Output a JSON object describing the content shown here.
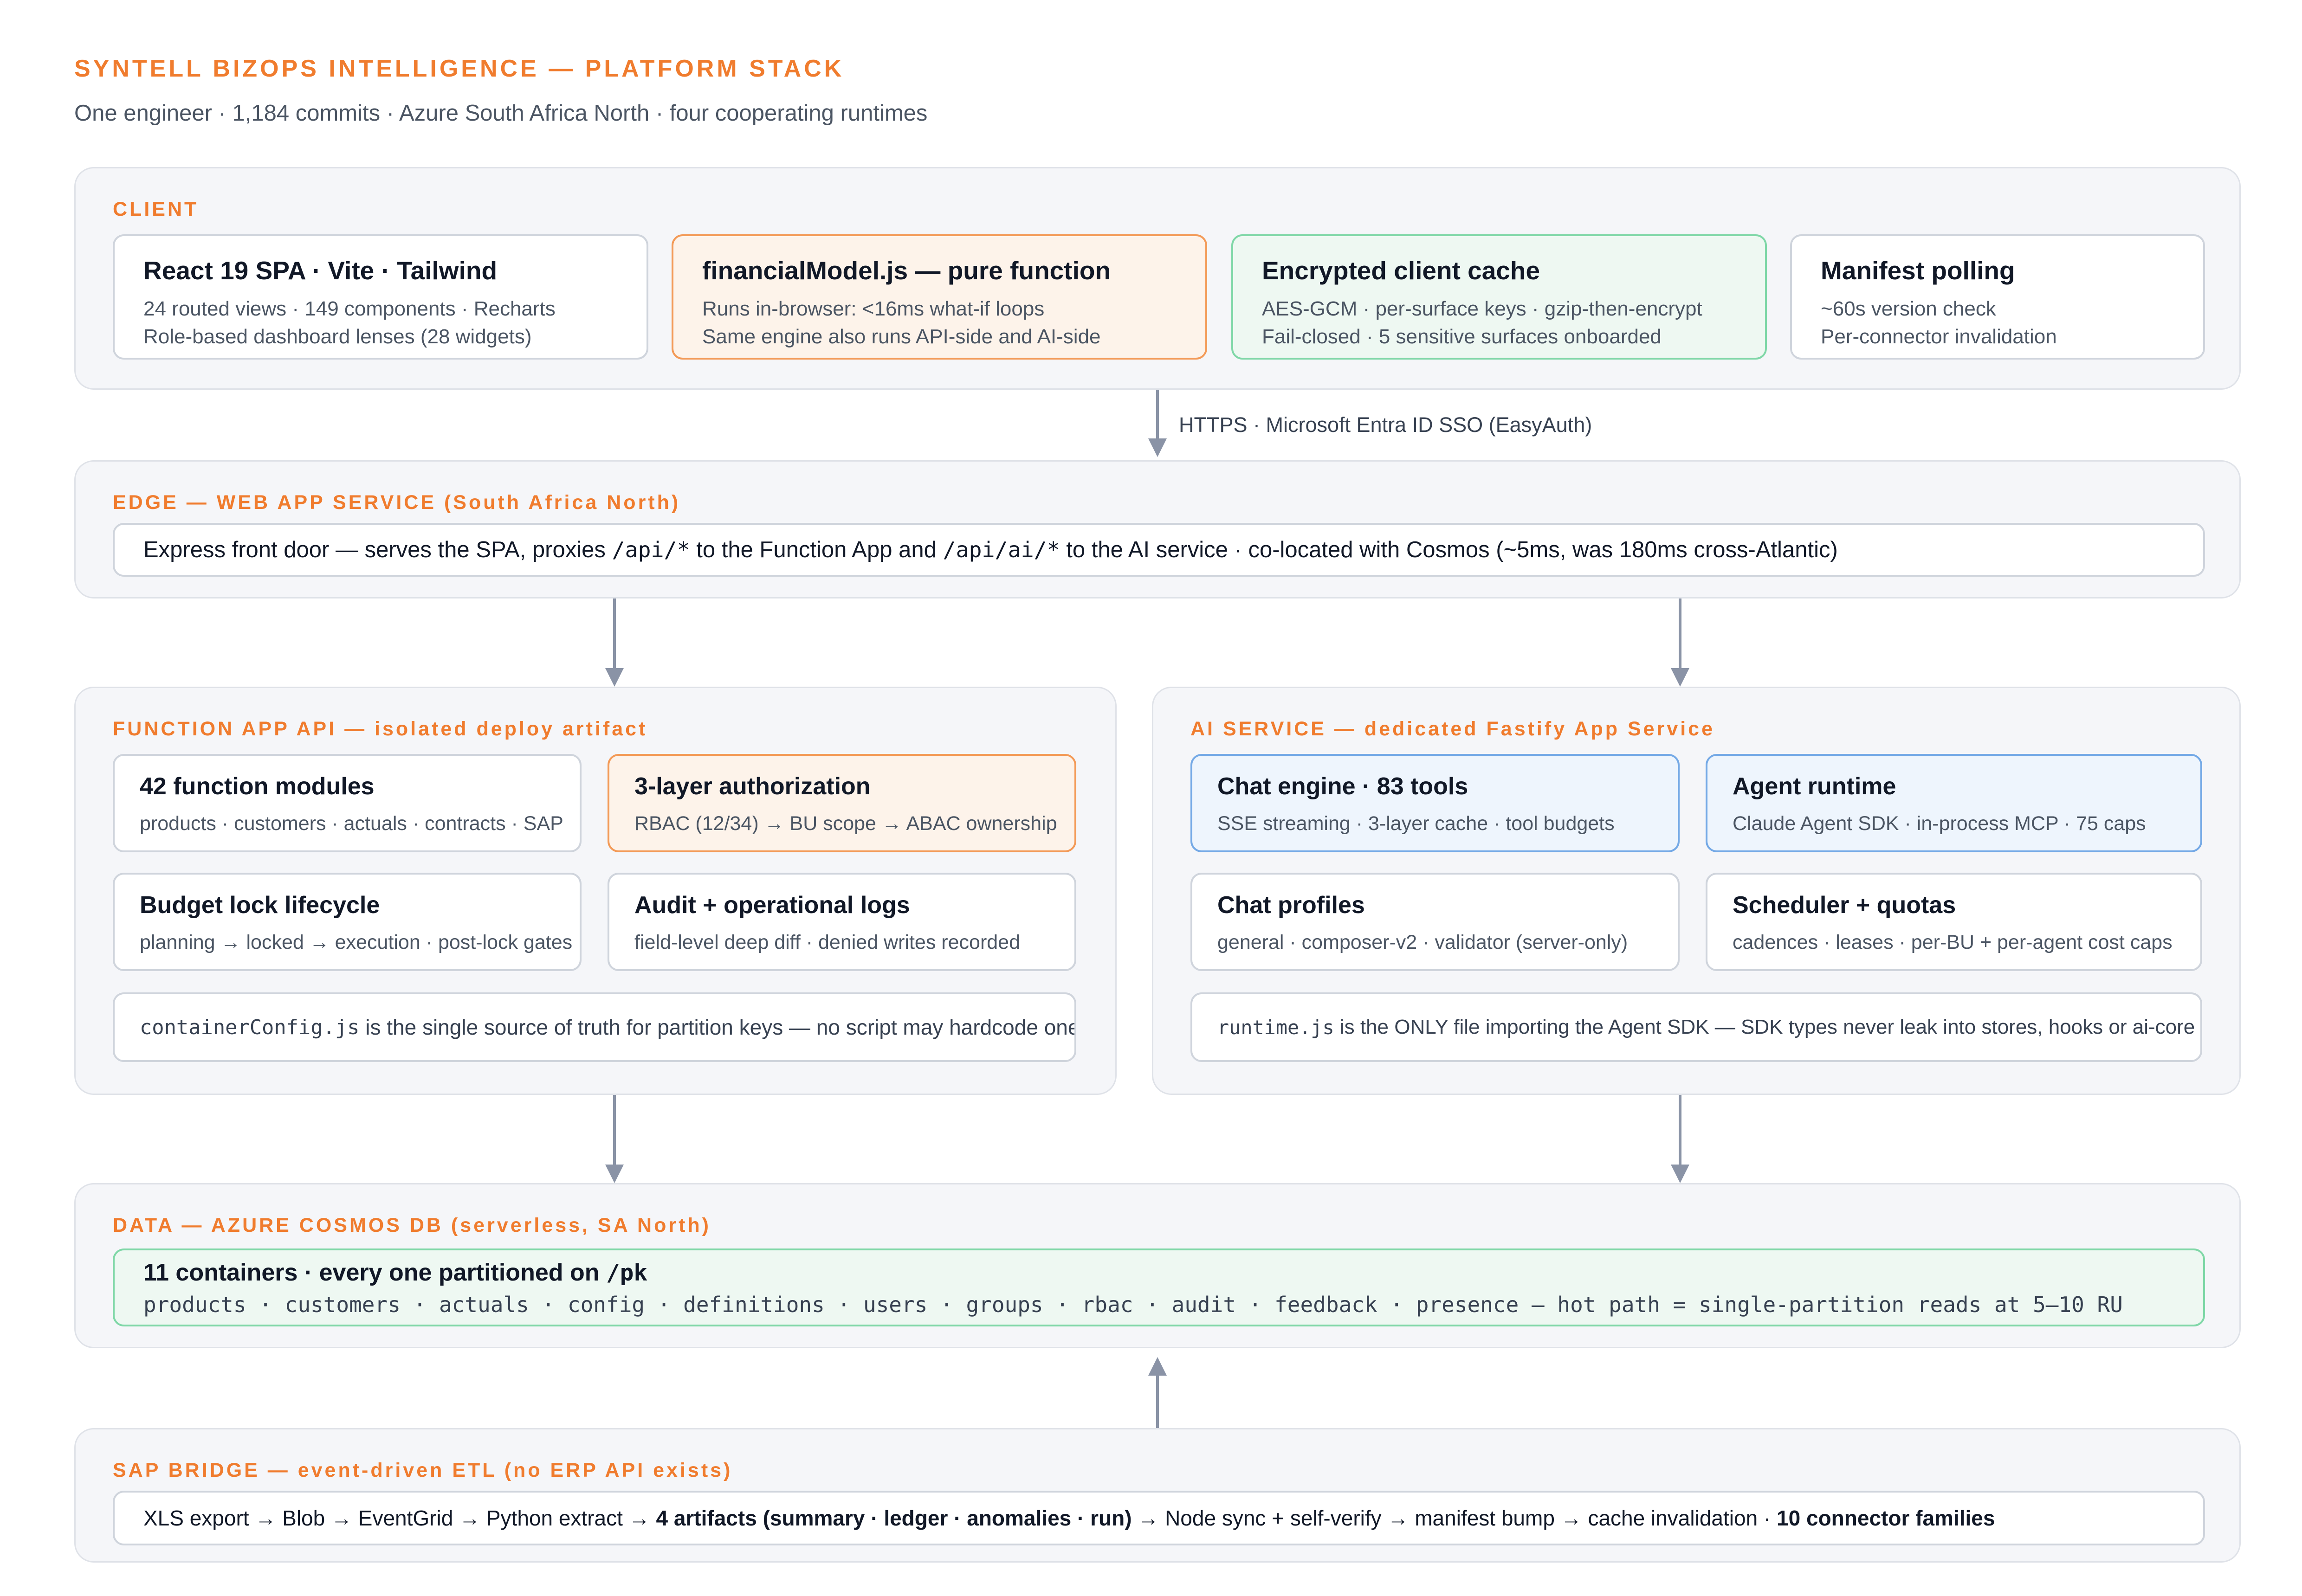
{
  "header": {
    "title": "SYNTELL BIZOPS INTELLIGENCE — PLATFORM STACK",
    "subtitle": "One engineer · 1,184 commits · Azure South Africa North · four cooperating runtimes"
  },
  "client": {
    "label": "CLIENT",
    "cards": [
      {
        "title": "React 19 SPA · Vite · Tailwind",
        "line1": "24 routed views · 149 components · Recharts",
        "line2": "Role-based dashboard lenses (28 widgets)"
      },
      {
        "title": "financialModel.js — pure function",
        "line1": "Runs in-browser: <16ms what-if loops",
        "line2": "Same engine also runs API-side and AI-side"
      },
      {
        "title": "Encrypted client cache",
        "line1": "AES-GCM · per-surface keys · gzip-then-encrypt",
        "line2": "Fail-closed · 5 sensitive surfaces onboarded"
      },
      {
        "title": "Manifest polling",
        "line1": "~60s version check",
        "line2": "Per-connector invalidation"
      }
    ]
  },
  "arrow_client_edge": {
    "label": "HTTPS · Microsoft Entra ID SSO (EasyAuth)"
  },
  "edge": {
    "label": "EDGE — WEB APP SERVICE (South Africa North)",
    "text_a": "Express front door — serves the SPA, proxies ",
    "code_a": "/api/*",
    "text_b": " to the Function App and ",
    "code_b": "/api/ai/*",
    "text_c": " to the AI service · co-located with Cosmos (~5ms, was 180ms cross-Atlantic)"
  },
  "function_app": {
    "label": "FUNCTION APP API — isolated deploy artifact",
    "cards": [
      {
        "title": "42 function modules",
        "line1": "products · customers · actuals · contracts · SAP"
      },
      {
        "title": "3-layer authorization",
        "line1": "RBAC (12/34) → BU scope → ABAC ownership"
      },
      {
        "title": "Budget lock lifecycle",
        "line1": "planning → locked → execution · post-lock gates"
      },
      {
        "title": "Audit + operational logs",
        "line1": "field-level deep diff · denied writes recorded"
      }
    ],
    "note_code": "containerConfig.js",
    "note_text": " is the single source of truth for partition keys — no script may hardcode one"
  },
  "ai_service": {
    "label": "AI SERVICE — dedicated Fastify App Service",
    "cards": [
      {
        "title": "Chat engine · 83 tools",
        "line1": "SSE streaming · 3-layer cache · tool budgets"
      },
      {
        "title": "Agent runtime",
        "line1": "Claude Agent SDK · in-process MCP · 75 caps"
      },
      {
        "title": "Chat profiles",
        "line1": "general · composer-v2 · validator (server-only)"
      },
      {
        "title": "Scheduler + quotas",
        "line1": "cadences · leases · per-BU + per-agent cost caps"
      }
    ],
    "note_code": "runtime.js",
    "note_text": " is the ONLY file importing the Agent SDK — SDK types never leak into stores, hooks or ai-core"
  },
  "data": {
    "label": "DATA — AZURE COSMOS DB (serverless, SA North)",
    "title_text": "11 containers · every one partitioned on ",
    "title_code": "/pk",
    "line": "products · customers · actuals · config · definitions · users · groups · rbac · audit · feedback · presence — hot path = single-partition reads at 5–10 RU"
  },
  "sap_bridge": {
    "label": "SAP BRIDGE — event-driven ETL (no ERP API exists)",
    "text_a": "XLS export → Blob → EventGrid → Python extract → ",
    "bold_a": "4 artifacts (summary · ledger · anomalies · run)",
    "text_b": " → Node sync + self-verify → manifest bump → cache invalidation · ",
    "bold_b": "10 connector families"
  },
  "colors": {
    "accent": "#f07c2e",
    "arrow": "#8a93a6",
    "orange_border": "#f39a57",
    "green_border": "#7fd7a7",
    "blue_border": "#74a9e6"
  }
}
